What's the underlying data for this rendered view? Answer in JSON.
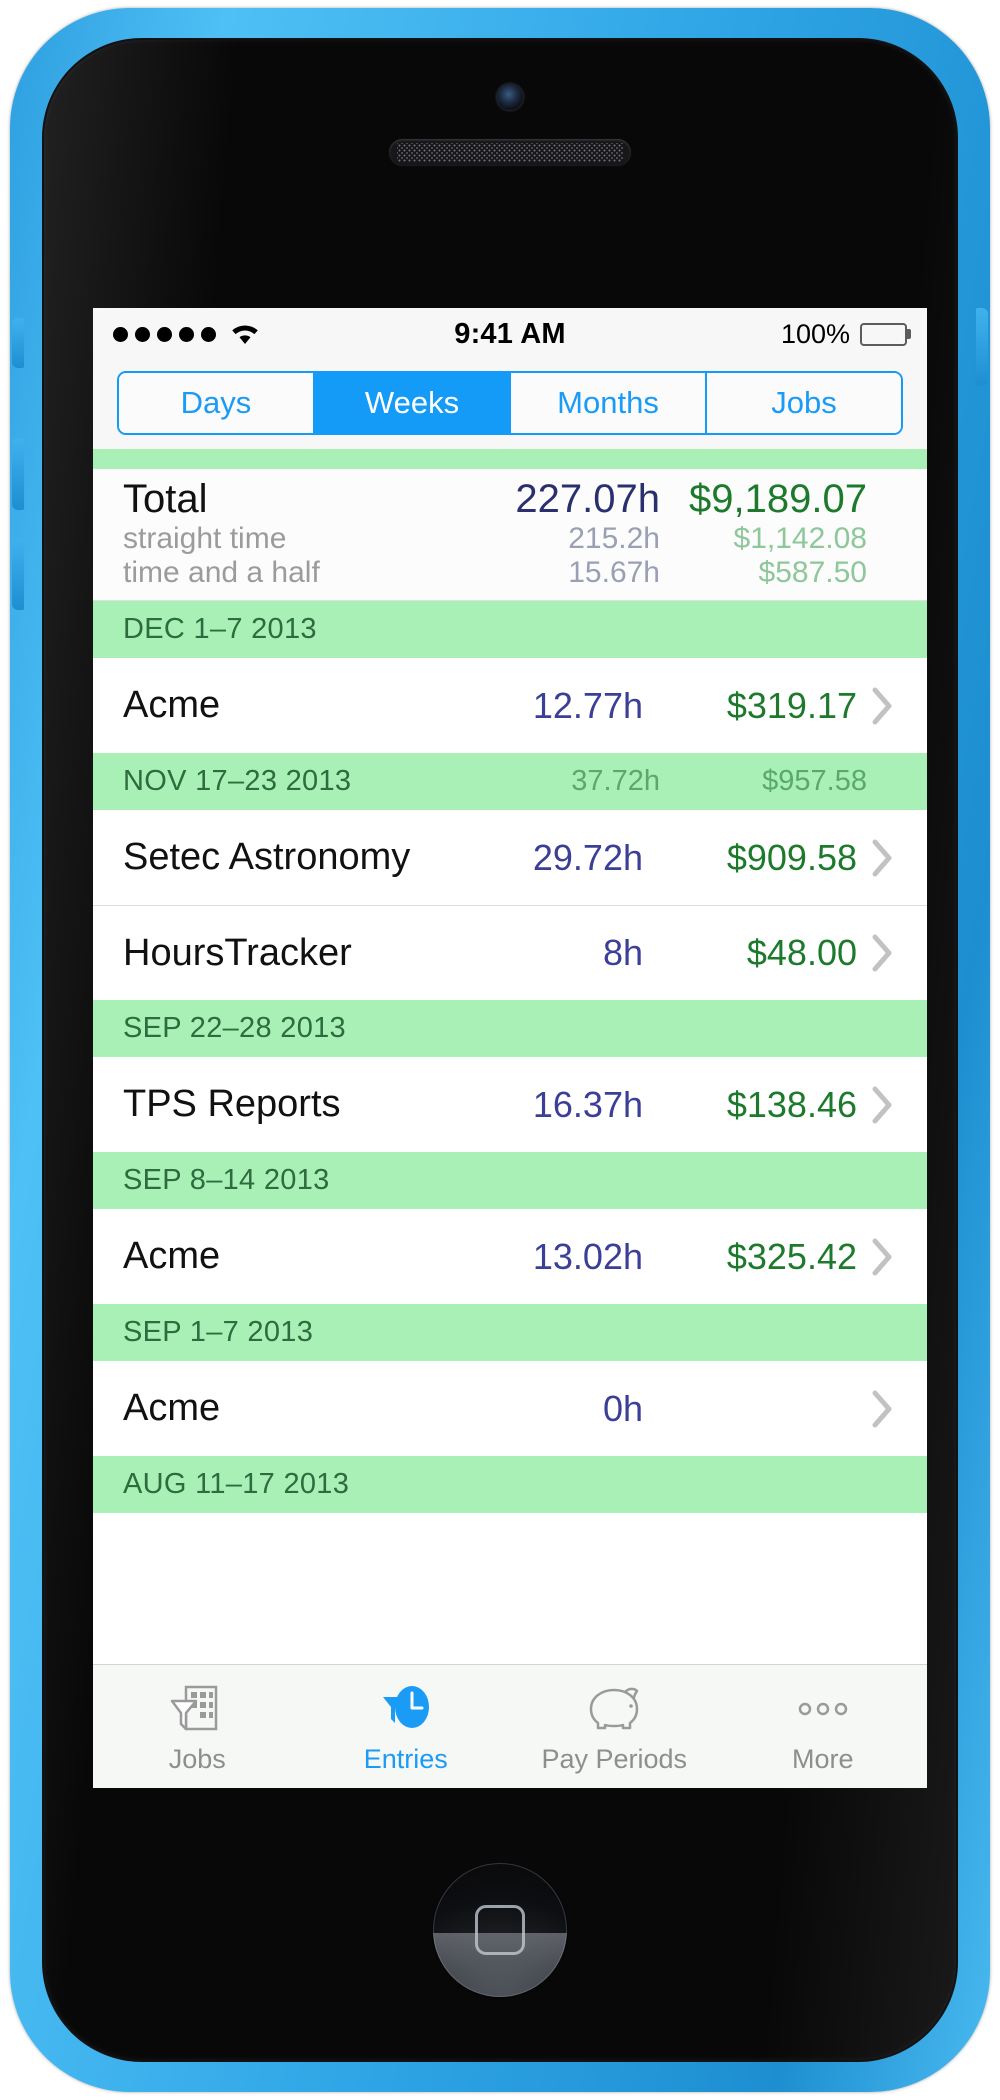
{
  "device": {
    "name": "iPhone 5c",
    "bezel_color": "#35a8e8",
    "body_color": "#080809"
  },
  "status_bar": {
    "signal_dots": 5,
    "wifi_icon": "wifi-icon",
    "time": "9:41 AM",
    "battery_percent": "100%",
    "battery_icon": "battery-full-icon"
  },
  "segmented_control": {
    "selected": "Weeks",
    "segments": [
      {
        "label": "Days"
      },
      {
        "label": "Weeks"
      },
      {
        "label": "Months"
      },
      {
        "label": "Jobs"
      }
    ]
  },
  "total": {
    "label": "Total",
    "hours": "227.07h",
    "amount": "$9,189.07",
    "rows": [
      {
        "label": "straight time",
        "hours": "215.2h",
        "amount": "$1,142.08"
      },
      {
        "label": "time and a half",
        "hours": "15.67h",
        "amount": "$587.50"
      }
    ]
  },
  "sections": [
    {
      "title": "DEC 1–7 2013",
      "hours": "",
      "amount": "",
      "entries": [
        {
          "name": "Acme",
          "hours": "12.77h",
          "amount": "$319.17",
          "chevron": "chevron-right-icon"
        }
      ]
    },
    {
      "title": "NOV 17–23 2013",
      "hours": "37.72h",
      "amount": "$957.58",
      "entries": [
        {
          "name": "Setec Astronomy",
          "hours": "29.72h",
          "amount": "$909.58",
          "chevron": "chevron-right-icon"
        },
        {
          "name": "HoursTracker",
          "hours": "8h",
          "amount": "$48.00",
          "chevron": "chevron-right-icon"
        }
      ]
    },
    {
      "title": "SEP 22–28 2013",
      "hours": "",
      "amount": "",
      "entries": [
        {
          "name": "TPS Reports",
          "hours": "16.37h",
          "amount": "$138.46",
          "chevron": "chevron-right-icon"
        }
      ]
    },
    {
      "title": "SEP 8–14 2013",
      "hours": "",
      "amount": "",
      "entries": [
        {
          "name": "Acme",
          "hours": "13.02h",
          "amount": "$325.42",
          "chevron": "chevron-right-icon"
        }
      ]
    },
    {
      "title": "SEP 1–7 2013",
      "hours": "",
      "amount": "",
      "entries": [
        {
          "name": "Acme",
          "hours": "0h",
          "amount": "",
          "chevron": "chevron-right-icon"
        }
      ]
    },
    {
      "title": "AUG 11–17 2013",
      "hours": "",
      "amount": "",
      "entries": []
    }
  ],
  "tab_bar": {
    "active": "Entries",
    "tabs": [
      {
        "label": "Jobs",
        "icon": "building-filter-icon"
      },
      {
        "label": "Entries",
        "icon": "clock-filter-icon"
      },
      {
        "label": "Pay Periods",
        "icon": "piggy-bank-icon"
      },
      {
        "label": "More",
        "icon": "ellipsis-icon"
      }
    ]
  },
  "colors": {
    "accent_blue": "#139bf7",
    "section_green": "#a9f0b6",
    "hours_blue": "#3b3f96",
    "amount_green": "#1d7a2c"
  }
}
